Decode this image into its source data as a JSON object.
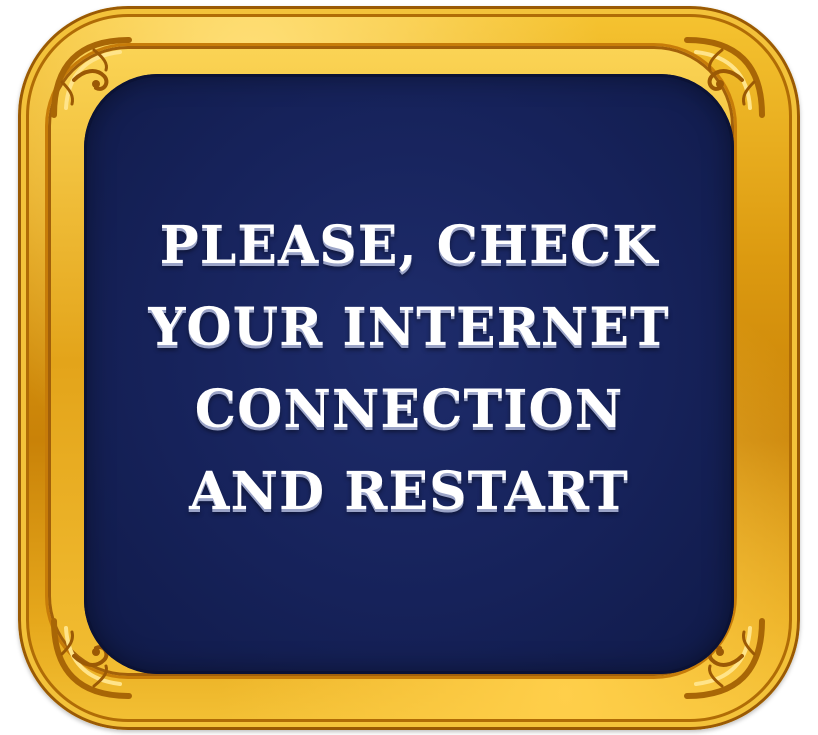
{
  "dialog": {
    "message_lines": [
      "PLEASE, CHECK",
      "YOUR INTERNET",
      "CONNECTION",
      "AND RESTART"
    ]
  },
  "colors": {
    "frame_gold": "#e0a316",
    "screen_navy": "#16225a",
    "text": "#ffffff"
  },
  "icons": {
    "corner_ornament": "scroll-ornament-icon"
  }
}
